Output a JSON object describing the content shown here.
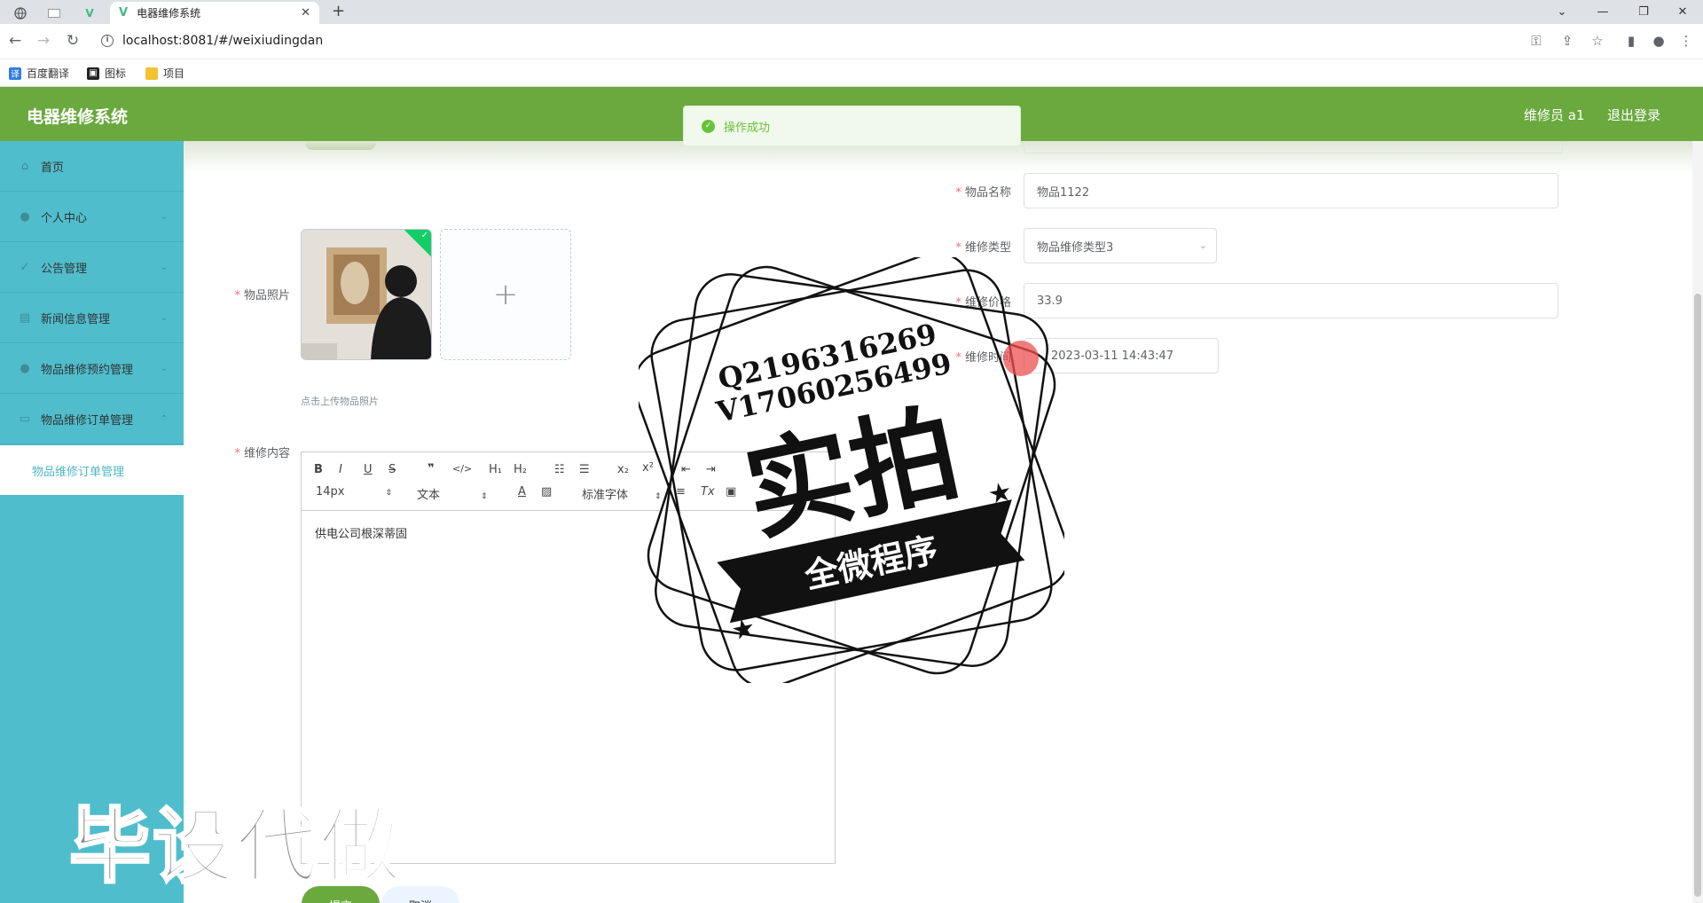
{
  "browser": {
    "tab_title": "电器维修系统",
    "url": "localhost:8081/#/weixiudingdan",
    "bookmarks": [
      "百度翻译",
      "图标",
      "项目"
    ]
  },
  "header": {
    "app_title": "电器维修系统",
    "user": "维修员 a1",
    "logout": "退出登录"
  },
  "sidebar": {
    "items": [
      {
        "label": "首页",
        "icon": "home-icon"
      },
      {
        "label": "个人中心",
        "icon": "user-icon"
      },
      {
        "label": "公告管理",
        "icon": "announcement-icon"
      },
      {
        "label": "新闻信息管理",
        "icon": "news-icon"
      },
      {
        "label": "物品维修预约管理",
        "icon": "user-icon"
      },
      {
        "label": "物品维修订单管理",
        "icon": "order-icon"
      }
    ],
    "active_sub": "物品维修订单管理"
  },
  "toast": {
    "message": "操作成功"
  },
  "form": {
    "photo_label": "物品照片",
    "upload_hint": "点击上传物品照片",
    "item_name_label": "物品名称",
    "item_name_value": "物品1122",
    "repair_type_label": "维修类型",
    "repair_type_value": "物品维修类型3",
    "price_label": "维修价格",
    "price_value": "33.9",
    "time_label": "维修时间",
    "time_value": "2023-03-11 14:43:47",
    "content_label": "维修内容",
    "content_value": "供电公司根深蒂固",
    "submit_label": "提交",
    "cancel_label": "取消"
  },
  "editor": {
    "font_size": "14px",
    "header_select": "文本",
    "font_family": "标准字体"
  },
  "watermark": {
    "stamp_line1": "Q2196316269",
    "stamp_line2": "V17060256499",
    "stamp_main": "实拍",
    "stamp_banner": "全微程序",
    "bottom_text": "毕设代做"
  }
}
